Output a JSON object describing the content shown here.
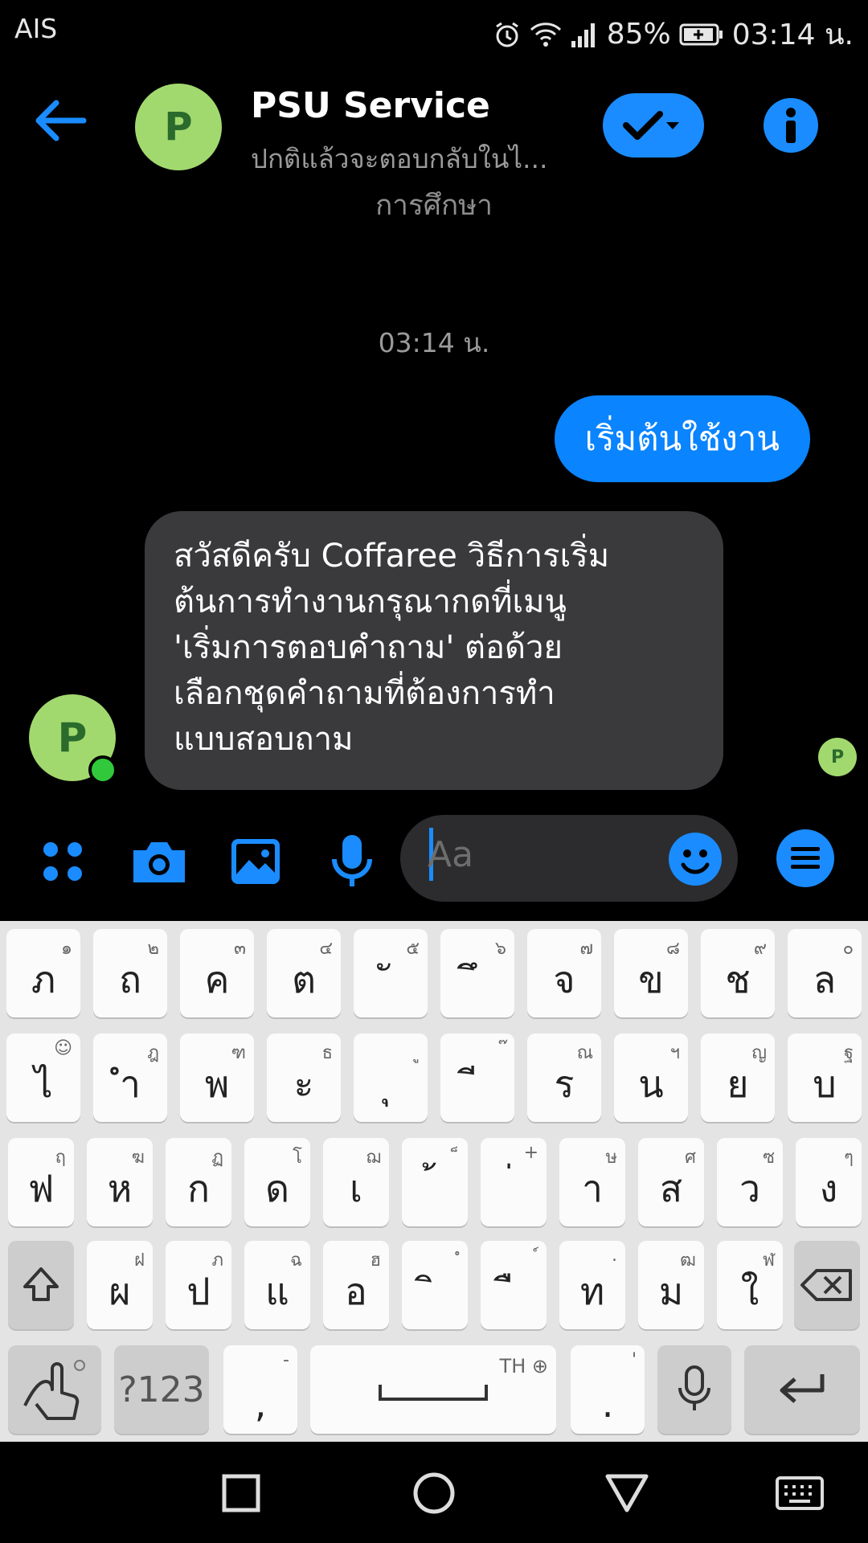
{
  "status_bar": {
    "carrier": "AIS",
    "battery": "85%",
    "time": "03:14 น."
  },
  "header": {
    "avatar_letter": "P",
    "contact_name": "PSU Service",
    "subtitle": "ปกติแล้วจะตอบกลับในไ...",
    "category": "การศึกษา"
  },
  "chat": {
    "timestamp": "03:14 น.",
    "outgoing_message": "เริ่มต้นใช้งาน",
    "incoming_message_lines": [
      "สวัสดีครับ Coffaree วิธีการเริ่ม",
      "ต้นการทำงานกรุณากดที่เมนู",
      "'เริ่มการตอบคำถาม' ต่อด้วย",
      "เลือกชุดคำถามที่ต้องการทำ",
      "แบบสอบถาม"
    ],
    "sender_avatar_letter": "P",
    "seen_avatar_letter": "P"
  },
  "composer": {
    "placeholder": "Aa"
  },
  "keyboard": {
    "row1": [
      {
        "main": "ภ",
        "hint": "๑"
      },
      {
        "main": "ถ",
        "hint": "๒"
      },
      {
        "main": "ค",
        "hint": "๓"
      },
      {
        "main": "ต",
        "hint": "๔"
      },
      {
        "main": "ั",
        "hint": "๕"
      },
      {
        "main": "ึ",
        "hint": "๖"
      },
      {
        "main": "จ",
        "hint": "๗"
      },
      {
        "main": "ข",
        "hint": "๘"
      },
      {
        "main": "ช",
        "hint": "๙"
      },
      {
        "main": "ล",
        "hint": "๐"
      }
    ],
    "row2": [
      {
        "main": "ไ",
        "hint": "☺"
      },
      {
        "main": "ำ",
        "hint": "ฎ"
      },
      {
        "main": "พ",
        "hint": "ฑ"
      },
      {
        "main": "ะ",
        "hint": "ธ"
      },
      {
        "main": "ุ",
        "hint": "ู"
      },
      {
        "main": "ี",
        "hint": "๊"
      },
      {
        "main": "ร",
        "hint": "ณ"
      },
      {
        "main": "น",
        "hint": "ฯ"
      },
      {
        "main": "ย",
        "hint": "ญ"
      },
      {
        "main": "บ",
        "hint": "ฐ"
      }
    ],
    "row3": [
      {
        "main": "ฟ",
        "hint": "ฤ"
      },
      {
        "main": "ห",
        "hint": "ฆ"
      },
      {
        "main": "ก",
        "hint": "ฏ"
      },
      {
        "main": "ด",
        "hint": "โ"
      },
      {
        "main": "เ",
        "hint": "ฌ"
      },
      {
        "main": "้",
        "hint": "็"
      },
      {
        "main": "่",
        "hint": "+"
      },
      {
        "main": "า",
        "hint": "ษ"
      },
      {
        "main": "ส",
        "hint": "ศ"
      },
      {
        "main": "ว",
        "hint": "ซ"
      },
      {
        "main": "ง",
        "hint": "ๆ"
      }
    ],
    "row4": [
      {
        "main": "ผ",
        "hint": "ฝ"
      },
      {
        "main": "ป",
        "hint": "ภ"
      },
      {
        "main": "แ",
        "hint": "ฉ"
      },
      {
        "main": "อ",
        "hint": "ฮ"
      },
      {
        "main": "ิ",
        "hint": "ํ"
      },
      {
        "main": "ื",
        "hint": "์"
      },
      {
        "main": "ท",
        "hint": "."
      },
      {
        "main": "ม",
        "hint": "ฒ"
      },
      {
        "main": "ใ",
        "hint": "ฬ"
      }
    ],
    "symbols_label": "?123",
    "comma_label": ",",
    "comma_hint": "-",
    "space_lang": "TH",
    "period_label": ".",
    "period_hint": "'"
  },
  "icons": {
    "back": "back-arrow-icon",
    "verify": "checkmark-dropdown-icon",
    "info": "info-icon",
    "apps": "apps-grid-icon",
    "camera": "camera-icon",
    "gallery": "image-icon",
    "mic": "microphone-icon",
    "emoji": "emoji-icon",
    "menu": "menu-icon"
  },
  "colors": {
    "accent": "#1a8cff",
    "outgoing_bubble": "#0a84ff",
    "incoming_bubble": "#3a3a3c",
    "avatar": "#a2d96e"
  }
}
